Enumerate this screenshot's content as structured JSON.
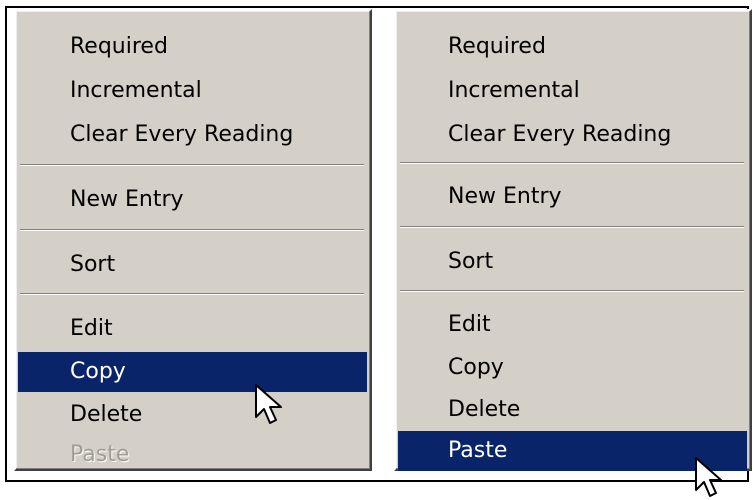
{
  "left_menu": {
    "items": [
      {
        "label": "Required",
        "state": "normal"
      },
      {
        "label": "Incremental",
        "state": "normal"
      },
      {
        "label": "Clear Every Reading",
        "state": "normal"
      },
      {
        "label": "New Entry",
        "state": "normal"
      },
      {
        "label": "Sort",
        "state": "normal"
      },
      {
        "label": "Edit",
        "state": "normal"
      },
      {
        "label": "Copy",
        "state": "selected"
      },
      {
        "label": "Delete",
        "state": "normal"
      },
      {
        "label": "Paste",
        "state": "disabled"
      }
    ]
  },
  "right_menu": {
    "items": [
      {
        "label": "Required",
        "state": "normal"
      },
      {
        "label": "Incremental",
        "state": "normal"
      },
      {
        "label": "Clear Every Reading",
        "state": "normal"
      },
      {
        "label": "New Entry",
        "state": "normal"
      },
      {
        "label": "Sort",
        "state": "normal"
      },
      {
        "label": "Edit",
        "state": "normal"
      },
      {
        "label": "Copy",
        "state": "normal"
      },
      {
        "label": "Delete",
        "state": "normal"
      },
      {
        "label": "Paste",
        "state": "selected"
      }
    ]
  },
  "colors": {
    "menu_background": "#d4d0c8",
    "selection_background": "#0a246a",
    "selection_text": "#ffffff",
    "disabled_text": "#a09d96"
  },
  "icons": {
    "left_cursor": "mouse-pointer-icon",
    "right_cursor": "mouse-pointer-icon"
  }
}
